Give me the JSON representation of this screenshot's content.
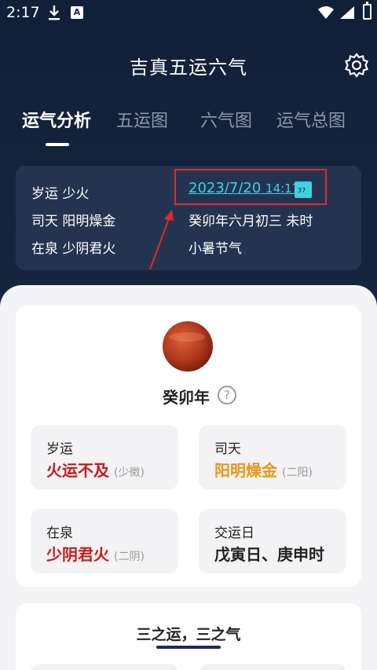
{
  "status_bar": {
    "time": "2:17",
    "app_icon_letter": "A"
  },
  "header": {
    "title": "吉真五运六气"
  },
  "tabs": [
    {
      "label": "运气分析",
      "active": true
    },
    {
      "label": "五运图",
      "active": false
    },
    {
      "label": "六气图",
      "active": false
    },
    {
      "label": "运气总图",
      "active": false
    }
  ],
  "info": {
    "suiyun": "岁运 少火",
    "sitian": "司天 阳明燥金",
    "zaiquan": "在泉 少阴君火",
    "date": "2023/7/20",
    "time": "14:17",
    "calendar_icon_text": "37",
    "lunar": "癸卯年六月初三 未时",
    "jieqi": "小暑节气"
  },
  "year_card": {
    "year": "癸卯年",
    "help": "?",
    "boxes": [
      {
        "label": "岁运",
        "value": "火运不及",
        "sub": "(少徵)"
      },
      {
        "label": "司天",
        "value": "阳明燥金",
        "sub": "(二阳)"
      },
      {
        "label": "在泉",
        "value": "少阴君火",
        "sub": "(二阴)"
      },
      {
        "label": "交运日",
        "value": "戊寅日、庚申时",
        "sub": ""
      }
    ]
  },
  "section2": {
    "title": "三之运，三之气"
  },
  "colors": {
    "accent": "#3fd2e0",
    "highlight_box": "#e0282b",
    "red": "#c81a1a",
    "orange": "#e8961c"
  }
}
